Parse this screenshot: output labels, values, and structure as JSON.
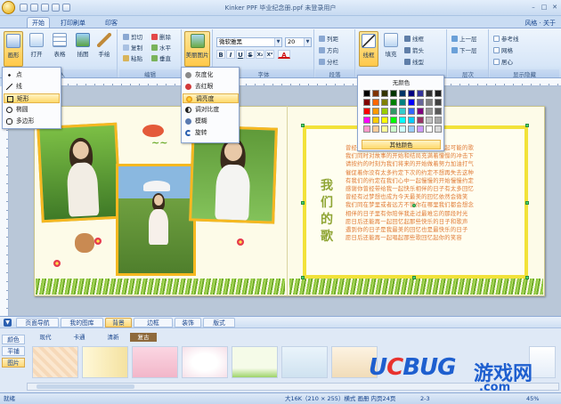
{
  "window": {
    "title": "Kinker PPF  毕业纪念册.ppf  未登录用户"
  },
  "tabs": [
    {
      "label": "开始",
      "active": true
    },
    {
      "label": "打印刷单",
      "active": false
    },
    {
      "label": "印客",
      "active": false
    }
  ],
  "tab_right": "风格 · 关于",
  "ribbon": {
    "groups": [
      "插入",
      "编辑",
      "字体",
      "段落",
      "",
      "层次",
      "显示隐藏"
    ],
    "insert": {
      "shape": "画形",
      "open": "打开",
      "table": "表格",
      "photo": "插图",
      "handwrite": "手绘"
    },
    "edit": {
      "cut": "剪切",
      "delete": "删除",
      "copy": "复制",
      "flip_h": "水平",
      "paste": "粘贴",
      "flip_v": "垂直",
      "select": "选择"
    },
    "beautify": {
      "label": "美丽图片"
    },
    "font": {
      "name": "微软雅黑",
      "size": "20",
      "bold": "B",
      "italic": "I",
      "underline": "U",
      "strike": "S",
      "sub": "X₂",
      "sup": "X²",
      "font_color": "A"
    },
    "paragraph": {
      "col": "列距",
      "dir": "方向",
      "spacing": "分栏"
    },
    "line": {
      "label": "线框",
      "fill": "填充",
      "line_color": "线框",
      "head": "箭头",
      "tail": "线型"
    },
    "layer": {
      "up": "上一层",
      "down": "下一层"
    },
    "display": {
      "ref": "参考线",
      "grid": "网格",
      "center": "居心"
    }
  },
  "shape_menu": {
    "items": [
      "点",
      "线",
      "矩形",
      "椭圆",
      "多边形"
    ],
    "highlighted": 2
  },
  "image_menu": {
    "items": [
      "灰度化",
      "去红眼",
      "调亮度",
      "调对比度",
      "模糊",
      "旋转"
    ],
    "highlighted": 2
  },
  "color_picker": {
    "no_color": "无颜色",
    "more": "其他颜色",
    "colors": [
      "#000000",
      "#7f3300",
      "#333300",
      "#003300",
      "#003366",
      "#000080",
      "#333399",
      "#333333",
      "#1c1c1c",
      "#800000",
      "#ff6600",
      "#808000",
      "#008000",
      "#008080",
      "#0000ff",
      "#666699",
      "#808080",
      "#404040",
      "#ff0000",
      "#ff9900",
      "#99cc00",
      "#339966",
      "#33cccc",
      "#3366ff",
      "#800080",
      "#969696",
      "#595959",
      "#ff00ff",
      "#ffcc00",
      "#ffff00",
      "#00ff00",
      "#00ffff",
      "#00ccff",
      "#993366",
      "#c0c0c0",
      "#a6a6a6",
      "#ff99cc",
      "#ffcc99",
      "#ffff99",
      "#ccffcc",
      "#ccffff",
      "#99ccff",
      "#cc99ff",
      "#ffffff",
      "#d9d9d9"
    ]
  },
  "poem": {
    "title": "我们的歌",
    "lines": [
      "曾经说好要一起在开满鲜花的小路上一起可能的歌",
      "我们同时对故事的开始和结局充满着憧憬的冲击下",
      "请按约的时刻为我们将来的开始做着努力加油打气",
      "催促着你没有太多约定下次的约定不想再失去这种",
      "有我们的约定在我们心中一起慢慢的开始慢慢约定",
      "感谢你曾经带给我一起快乐相伴的日子有太多回忆",
      "曾经有过梦想也成为今天最美的回忆依然会微笑",
      "我们同在梦里或者远方不管你在哪里我们都会想念",
      "相伴的日子里有你陪伴我走过最难忘的那段时光",
      "愿日后还能再一起回忆起那些快乐的日子和歌声",
      "遇到你的日子是我最美的回忆也是最快乐的日子",
      "愿日后还能再一起唱起那些歌回忆起你的笑容"
    ]
  },
  "bottom_panel": {
    "tabs": [
      "页面导航",
      "我的图库",
      "背景",
      "边框",
      "装饰",
      "版式"
    ],
    "active_tab": 2,
    "side_tabs": [
      "颜色",
      "平铺",
      "图片"
    ],
    "active_side": 2,
    "subcats": [
      "现代",
      "卡通",
      "清新",
      "复古"
    ],
    "active_subcat": 3
  },
  "statusbar": {
    "left": "就绪",
    "size": "大16K（210 × 255）横式 画册 内页24页",
    "page": "2-3",
    "zoom": "45%"
  },
  "watermark": {
    "brand_u": "U",
    "brand_c": "C",
    "brand_bug": "BUG",
    "cn": "游戏网",
    "com": ".com"
  }
}
